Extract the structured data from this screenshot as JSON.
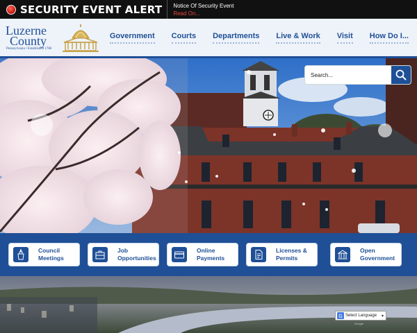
{
  "alert": {
    "title": "SECURITY EVENT ALERT",
    "message": "Notice Of Security Event",
    "link": "Read On..."
  },
  "logo": {
    "name_line1": "Luzerne",
    "name_line2": "County",
    "tagline": "Pennsylvania • Established 1786"
  },
  "nav": {
    "items": [
      "Government",
      "Courts",
      "Departments",
      "Live & Work",
      "Visit",
      "How Do I..."
    ]
  },
  "search": {
    "placeholder": "Search..."
  },
  "quick_links": [
    {
      "label": "Council\nMeetings",
      "icon": "podium-icon"
    },
    {
      "label": "Job\nOpportunities",
      "icon": "briefcase-icon"
    },
    {
      "label": "Online\nPayments",
      "icon": "credit-card-icon"
    },
    {
      "label": "Licenses &\nPermits",
      "icon": "document-icon"
    },
    {
      "label": "Open\nGovernment",
      "icon": "courthouse-icon"
    }
  ],
  "translate": {
    "label": "Select Language",
    "powered": "Google"
  },
  "colors": {
    "brand_blue": "#1f4f96",
    "alert_red": "#e8473c",
    "header_bg": "#eef3f9"
  }
}
